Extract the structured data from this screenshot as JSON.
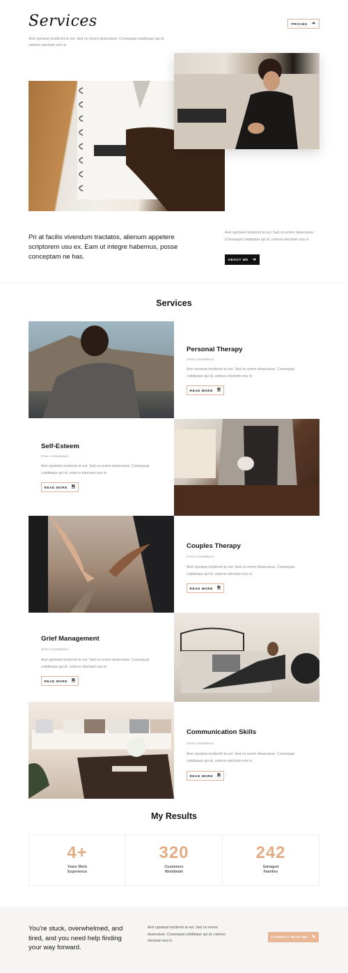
{
  "header": {
    "title": "Services",
    "intro": "Aret oporteat inciderint te est. Sed no errem deseruisse. Consequat cotidieque qui id, ceteros electram eos in.",
    "pricing_label": "PRICING"
  },
  "intro_section": {
    "lead": "Pri at facilis vivendum tractatos, alienum appetere scriptorem usu ex. Eam ut integre habemus, posse conceptam ne has.",
    "side_text": "Aret oporteat inciderint te est. Sed no errem deseruisse. Consequat cotidieque qui id, ceteros electram eos in.",
    "about_label": "ABOUT ME"
  },
  "services": {
    "title": "Services",
    "read_more": "READ MORE",
    "items": [
      {
        "title": "Personal Therapy",
        "sub": "(Free Consultation)",
        "text": "Aret oporteat inciderint te est. Sed no errem deseruisse. Consequat cotidieque qui id, ceteros electram eos in."
      },
      {
        "title": "Self-Esteem",
        "sub": "(Free Consultation)",
        "text": "Aret oporteat inciderint te est. Sed no errem deseruisse. Consequat cotidieque qui id, ceteros electram eos in."
      },
      {
        "title": "Couples Therapy",
        "sub": "(Free Consultation)",
        "text": "Aret oporteat inciderint te est. Sed no errem deseruisse. Consequat cotidieque qui id, ceteros electram eos in."
      },
      {
        "title": "Grief Management",
        "sub": "(Free Consultation)",
        "text": "Aret oporteat inciderint te est. Sed no errem deseruisse. Consequat cotidieque qui id, ceteros electram eos in."
      },
      {
        "title": "Communication Skills",
        "sub": "(Free Consultation)",
        "text": "Aret oporteat inciderint te est. Sed no errem deseruisse. Consequat cotidieque qui id, ceteros electram eos in."
      }
    ]
  },
  "results": {
    "title": "My Results",
    "stats": [
      {
        "value": "4+",
        "label": "Years Work Experience"
      },
      {
        "value": "320",
        "label": "Customers Worldwide"
      },
      {
        "value": "242",
        "label": "Salvaged Families"
      }
    ]
  },
  "cta": {
    "heading": "You're stuck, overwhelmed, and tired, and you need help finding your way forward.",
    "text": "Aret oporteat inciderint te est. Sed no errem deseruisse. Consequat cotidieque qui id, ceteros electram eos in.",
    "button_label": "CONNECT WITH ME"
  },
  "colors": {
    "accent": "#e2ac85",
    "dark": "#111111",
    "muted": "#8a8a8a"
  }
}
